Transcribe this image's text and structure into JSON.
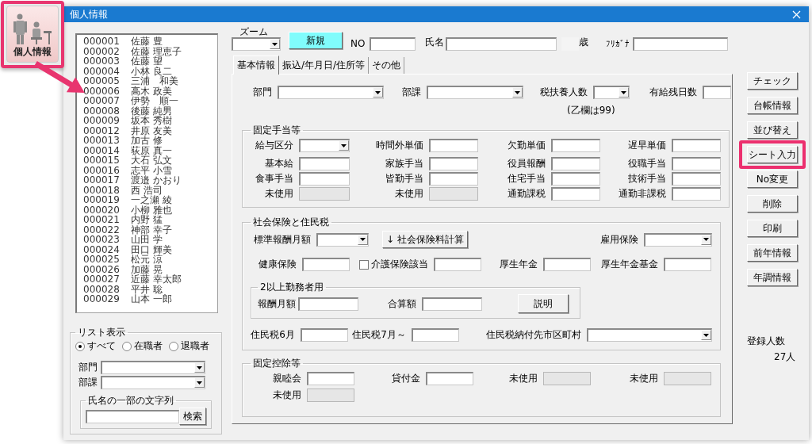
{
  "launcher": {
    "label": "個人情報",
    "highlighted": true
  },
  "window": {
    "title": "個人情報"
  },
  "employee_list": [
    {
      "no": "000001",
      "name": "佐藤 豊"
    },
    {
      "no": "000002",
      "name": "佐藤 理恵子"
    },
    {
      "no": "000003",
      "name": "佐藤 望"
    },
    {
      "no": "000004",
      "name": "小林 良二"
    },
    {
      "no": "000005",
      "name": "三浦　和美"
    },
    {
      "no": "000006",
      "name": "高木 政美"
    },
    {
      "no": "000007",
      "name": "伊勢　順一"
    },
    {
      "no": "000008",
      "name": "後藤 純男"
    },
    {
      "no": "000009",
      "name": "坂本 秀樹"
    },
    {
      "no": "000012",
      "name": "井原 友美"
    },
    {
      "no": "000013",
      "name": "加古 修"
    },
    {
      "no": "000014",
      "name": "荻原 真一"
    },
    {
      "no": "000015",
      "name": "大石 弘文"
    },
    {
      "no": "000016",
      "name": "志平 小雪"
    },
    {
      "no": "000017",
      "name": "渡邉 かおり"
    },
    {
      "no": "000018",
      "name": "西 浩司"
    },
    {
      "no": "000019",
      "name": "一之瀬 綾"
    },
    {
      "no": "000020",
      "name": "小柳 雅也"
    },
    {
      "no": "000021",
      "name": "内野 猛"
    },
    {
      "no": "000022",
      "name": "神部 幸子"
    },
    {
      "no": "000023",
      "name": "山田 学"
    },
    {
      "no": "000024",
      "name": "田口 輝美"
    },
    {
      "no": "000025",
      "name": "松元 涼"
    },
    {
      "no": "000026",
      "name": "加藤 晃"
    },
    {
      "no": "000027",
      "name": "近藤 幸太郎"
    },
    {
      "no": "000028",
      "name": "平井 聡"
    },
    {
      "no": "000029",
      "name": "山本 一郎"
    }
  ],
  "list_display": {
    "title": "リスト表示",
    "options": [
      {
        "label": "すべて",
        "selected": true
      },
      {
        "label": "在職者",
        "selected": false
      },
      {
        "label": "退職者",
        "selected": false
      }
    ],
    "filters": [
      {
        "label": "部門"
      },
      {
        "label": "部課"
      }
    ],
    "name_search": {
      "title": "氏名の一部の文字列",
      "button": "検索"
    }
  },
  "header": {
    "zoom_label": "ズーム",
    "new_button": "新規",
    "no_label": "NO",
    "name_label": "氏名",
    "age_unit": "歳",
    "kana_label": "ﾌﾘｶﾞﾅ"
  },
  "tabs": [
    {
      "label": "基本情報",
      "selected": true
    },
    {
      "label": "振込/年月日/住所等",
      "selected": false
    },
    {
      "label": "その他",
      "selected": false
    }
  ],
  "basic_fields": [
    {
      "label": "部門",
      "kind": "combo",
      "disabled": false
    },
    {
      "label": "部課",
      "kind": "combo",
      "disabled": false
    },
    {
      "label": "税扶養人数",
      "kind": "combo",
      "disabled": false
    },
    {
      "label": "有給残日数",
      "kind": "text",
      "disabled": false
    }
  ],
  "basic_note": "(乙欄は99)",
  "groups": [
    {
      "title": "固定手当等",
      "rows": [
        {
          "kind": "fields",
          "fields": [
            {
              "label": "給与区分",
              "kind": "combo",
              "disabled": false
            },
            {
              "label": "時間外単価",
              "kind": "text",
              "disabled": false
            },
            {
              "label": "欠勤単価",
              "kind": "text",
              "disabled": false
            },
            {
              "label": "遅早単価",
              "kind": "text",
              "disabled": false
            }
          ]
        },
        {
          "kind": "fields",
          "fields": [
            {
              "label": "基本給",
              "kind": "text",
              "disabled": false
            },
            {
              "label": "家族手当",
              "kind": "text",
              "disabled": false
            },
            {
              "label": "役員報酬",
              "kind": "text",
              "disabled": false
            },
            {
              "label": "役職手当",
              "kind": "text",
              "disabled": false
            }
          ]
        },
        {
          "kind": "fields",
          "fields": [
            {
              "label": "食事手当",
              "kind": "text",
              "disabled": false
            },
            {
              "label": "皆勤手当",
              "kind": "text",
              "disabled": false
            },
            {
              "label": "住宅手当",
              "kind": "text",
              "disabled": false
            },
            {
              "label": "技術手当",
              "kind": "text",
              "disabled": false
            }
          ]
        },
        {
          "kind": "fields",
          "fields": [
            {
              "label": "未使用",
              "kind": "text",
              "disabled": true
            },
            {
              "label": "未使用",
              "kind": "text",
              "disabled": true
            },
            {
              "label": "通勤課税",
              "kind": "text",
              "disabled": false
            },
            {
              "label": "通勤非課税",
              "kind": "text",
              "disabled": false
            }
          ]
        }
      ]
    },
    {
      "title": "社会保険と住民税",
      "rows": [
        {
          "kind": "fields",
          "fields": [
            {
              "label": "標準報酬月額",
              "kind": "combo",
              "disabled": false
            },
            {
              "label": "↓ 社会保険料計算",
              "kind": "button",
              "disabled": false
            },
            {
              "label": "雇用保険",
              "kind": "combo",
              "disabled": false
            }
          ]
        },
        {
          "kind": "fields",
          "fields": [
            {
              "label": "健康保険",
              "kind": "text",
              "disabled": false
            },
            {
              "label": "介護保険該当",
              "kind": "check_text",
              "checked": false,
              "disabled": false
            },
            {
              "label": "厚生年金",
              "kind": "text",
              "disabled": false
            },
            {
              "label": "厚生年金基金",
              "kind": "text",
              "disabled": false
            }
          ]
        },
        {
          "kind": "subgroup",
          "title": "2以上勤務者用",
          "fields": [
            {
              "label": "報酬月額",
              "kind": "text",
              "disabled": false
            },
            {
              "label": "合算額",
              "kind": "text",
              "disabled": false
            },
            {
              "label": "説明",
              "kind": "button",
              "disabled": false
            }
          ]
        },
        {
          "kind": "fields",
          "fields": [
            {
              "label": "住民税6月",
              "kind": "text",
              "disabled": false
            },
            {
              "label": "住民税7月～",
              "kind": "text",
              "disabled": false
            },
            {
              "label": "住民税納付先市区町村",
              "kind": "combo",
              "disabled": false
            }
          ]
        }
      ]
    },
    {
      "title": "固定控除等",
      "rows": [
        {
          "kind": "fields",
          "fields": [
            {
              "label": "親睦会",
              "kind": "text",
              "disabled": false
            },
            {
              "label": "貸付金",
              "kind": "text",
              "disabled": false
            },
            {
              "label": "未使用",
              "kind": "text",
              "disabled": true
            },
            {
              "label": "未使用",
              "kind": "text",
              "disabled": true
            }
          ]
        },
        {
          "kind": "fields",
          "fields": [
            {
              "label": "未使用",
              "kind": "text",
              "disabled": true
            }
          ]
        }
      ]
    }
  ],
  "side_buttons": [
    {
      "label": "チェック",
      "highlighted": false
    },
    {
      "label": "台帳情報",
      "highlighted": false
    },
    {
      "label": "並び替え",
      "highlighted": false
    },
    {
      "label": "シート入力",
      "highlighted": true
    },
    {
      "label": "No変更",
      "highlighted": false
    },
    {
      "label": "削除",
      "highlighted": false
    },
    {
      "label": "印刷",
      "highlighted": false
    },
    {
      "label": "前年情報",
      "highlighted": false
    },
    {
      "label": "年調情報",
      "highlighted": false
    }
  ],
  "registered": {
    "label": "登録人数",
    "count": "27人"
  }
}
